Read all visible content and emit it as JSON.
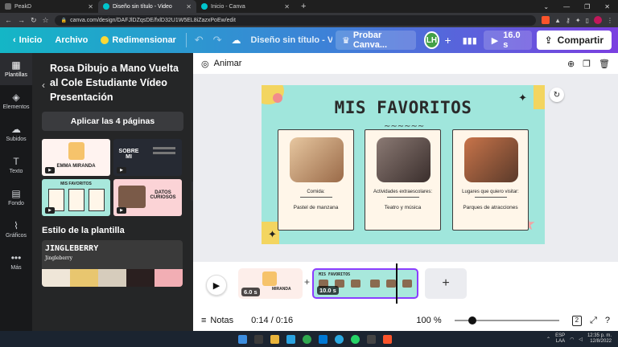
{
  "browser": {
    "tabs": [
      {
        "label": "PeakD",
        "active": false
      },
      {
        "label": "Diseño sin título - Video",
        "active": true
      },
      {
        "label": "Inicio - Canva",
        "active": false
      }
    ],
    "url": "canva.com/design/DAFJlDZqsDE/fxlD32U1W5EL8iZazxPoEw/edit"
  },
  "topbar": {
    "home": "Inicio",
    "file": "Archivo",
    "resize": "Redimensionar",
    "title": "Diseño sin título - V...",
    "try_pro": "Probar Canva...",
    "avatar_initials": "LH",
    "duration": "16.0 s",
    "share": "Compartir"
  },
  "rail": [
    {
      "label": "Plantillas",
      "icon": "templates-icon",
      "glyph": "▦"
    },
    {
      "label": "Elementos",
      "icon": "shapes-icon",
      "glyph": "◈"
    },
    {
      "label": "Subidos",
      "icon": "upload-icon",
      "glyph": "☁"
    },
    {
      "label": "Texto",
      "icon": "text-icon",
      "glyph": "T"
    },
    {
      "label": "Fondo",
      "icon": "background-icon",
      "glyph": "▤"
    },
    {
      "label": "Gráficos",
      "icon": "charts-icon",
      "glyph": "📈"
    },
    {
      "label": "Más",
      "icon": "more-icon",
      "glyph": "•••"
    }
  ],
  "panel": {
    "template_title": "Rosa Dibujo a Mano Vuelta al Cole Estudiante Vídeo Presentación",
    "apply_button": "Aplicar las 4 páginas",
    "thumbs": [
      "EMMA MIRANDA",
      "SOBRE MI",
      "MIS FAVORITOS",
      "DATOS CURIOSOS"
    ],
    "style_header": "Estilo de la plantilla",
    "style_name": "JINGLEBERRY",
    "style_sub": "Jingleberry",
    "swatches": [
      "#efe6d8",
      "#e8c66f",
      "#d6ccbc",
      "#2a1f1f",
      "#f2aeb4"
    ]
  },
  "canvas": {
    "animate": "Animar",
    "slide_title": "MIS FAVORITOS",
    "cards": [
      {
        "label": "Comida:",
        "value": "Pastel de manzana"
      },
      {
        "label": "Actividades extraescolares:",
        "value": "Teatro y música"
      },
      {
        "label": "Lugares que quiero visitar:",
        "value": "Parques de atracciones"
      }
    ]
  },
  "timeline": {
    "clips": [
      {
        "duration": "6.0 s",
        "caption": "MIRANDA"
      },
      {
        "duration": "10.0 s",
        "caption": "MIS FAVORITOS"
      }
    ]
  },
  "footer": {
    "notes": "Notas",
    "time": "0:14 / 0:16",
    "zoom": "100 %",
    "zoom_fraction": 0.14,
    "pages": "2"
  },
  "taskbar": {
    "lang1": "ESP",
    "lang2": "LAA",
    "time": "12:35 p. m.",
    "date": "12/8/2022"
  }
}
